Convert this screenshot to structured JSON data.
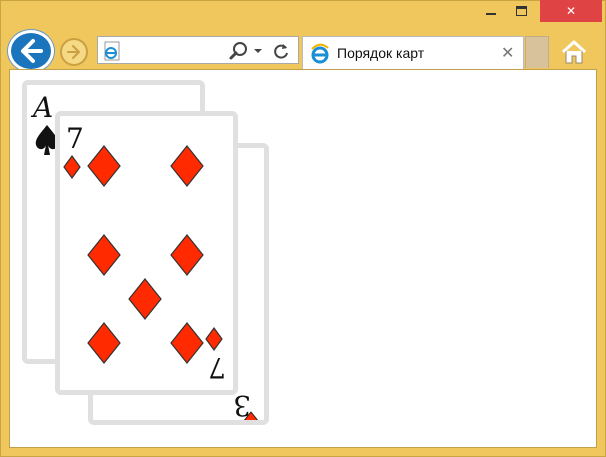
{
  "window": {
    "minimize_glyph": "minimize-icon",
    "maximize_glyph": "maximize-icon",
    "close_symbol": "✕"
  },
  "tab": {
    "title": "Порядок карт",
    "close_symbol": "✕"
  },
  "cards": [
    {
      "name": "ace-of-spades",
      "rank": "A",
      "suit": "spades",
      "color": "#000000"
    },
    {
      "name": "seven-of-diamonds",
      "rank": "7",
      "suit": "diamonds",
      "color": "#ff2a00"
    },
    {
      "name": "three-of-hearts",
      "rank": "3",
      "suit": "hearts",
      "color": "#ff2a00"
    }
  ],
  "colors": {
    "frame": "#f0c75d",
    "close_button": "#e04343",
    "back_button": "#1a75bd",
    "card_border": "#e0e0e0",
    "suit_red": "#ff2a00"
  }
}
